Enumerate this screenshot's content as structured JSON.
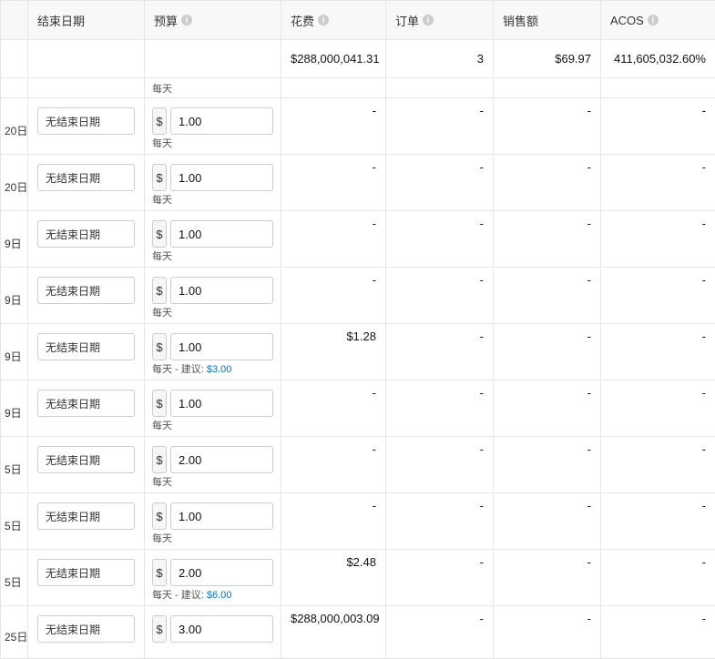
{
  "headers": {
    "end_date": "结束日期",
    "budget": "预算",
    "spend": "花费",
    "orders": "订单",
    "sales": "销售额",
    "acos": "ACOS"
  },
  "summary": {
    "spend": "$288,000,041.31",
    "orders": "3",
    "sales": "$69.97",
    "acos": "411,605,032.60%"
  },
  "labels": {
    "daily": "每天",
    "daily_suggest_prefix": "每天 - 建议: ",
    "no_end_date": "无结束日期",
    "currency": "$"
  },
  "rows": [
    {
      "start_frag": "20日",
      "end": "无结束日期",
      "budget": "1.00",
      "note": "daily",
      "spend": "-",
      "orders": "-",
      "sales": "-",
      "acos": "-"
    },
    {
      "start_frag": "20日",
      "end": "无结束日期",
      "budget": "1.00",
      "note": "daily",
      "spend": "-",
      "orders": "-",
      "sales": "-",
      "acos": "-"
    },
    {
      "start_frag": "9日",
      "end": "无结束日期",
      "budget": "1.00",
      "note": "daily",
      "spend": "-",
      "orders": "-",
      "sales": "-",
      "acos": "-"
    },
    {
      "start_frag": "9日",
      "end": "无结束日期",
      "budget": "1.00",
      "note": "daily",
      "spend": "-",
      "orders": "-",
      "sales": "-",
      "acos": "-"
    },
    {
      "start_frag": "9日",
      "end": "无结束日期",
      "budget": "1.00",
      "note": "suggest",
      "suggest": "$3.00",
      "spend": "$1.28",
      "orders": "-",
      "sales": "-",
      "acos": "-"
    },
    {
      "start_frag": "9日",
      "end": "无结束日期",
      "budget": "1.00",
      "note": "daily",
      "spend": "-",
      "orders": "-",
      "sales": "-",
      "acos": "-"
    },
    {
      "start_frag": "5日",
      "end": "无结束日期",
      "budget": "2.00",
      "note": "daily",
      "spend": "-",
      "orders": "-",
      "sales": "-",
      "acos": "-"
    },
    {
      "start_frag": "5日",
      "end": "无结束日期",
      "budget": "1.00",
      "note": "daily",
      "spend": "-",
      "orders": "-",
      "sales": "-",
      "acos": "-"
    },
    {
      "start_frag": "5日",
      "end": "无结束日期",
      "budget": "2.00",
      "note": "suggest",
      "suggest": "$6.00",
      "spend": "$2.48",
      "orders": "-",
      "sales": "-",
      "acos": "-"
    },
    {
      "start_frag": "25日",
      "end": "无结束日期",
      "budget": "3.00",
      "note": "none",
      "spend": "$288,000,003.09",
      "orders": "-",
      "sales": "-",
      "acos": "-"
    }
  ]
}
